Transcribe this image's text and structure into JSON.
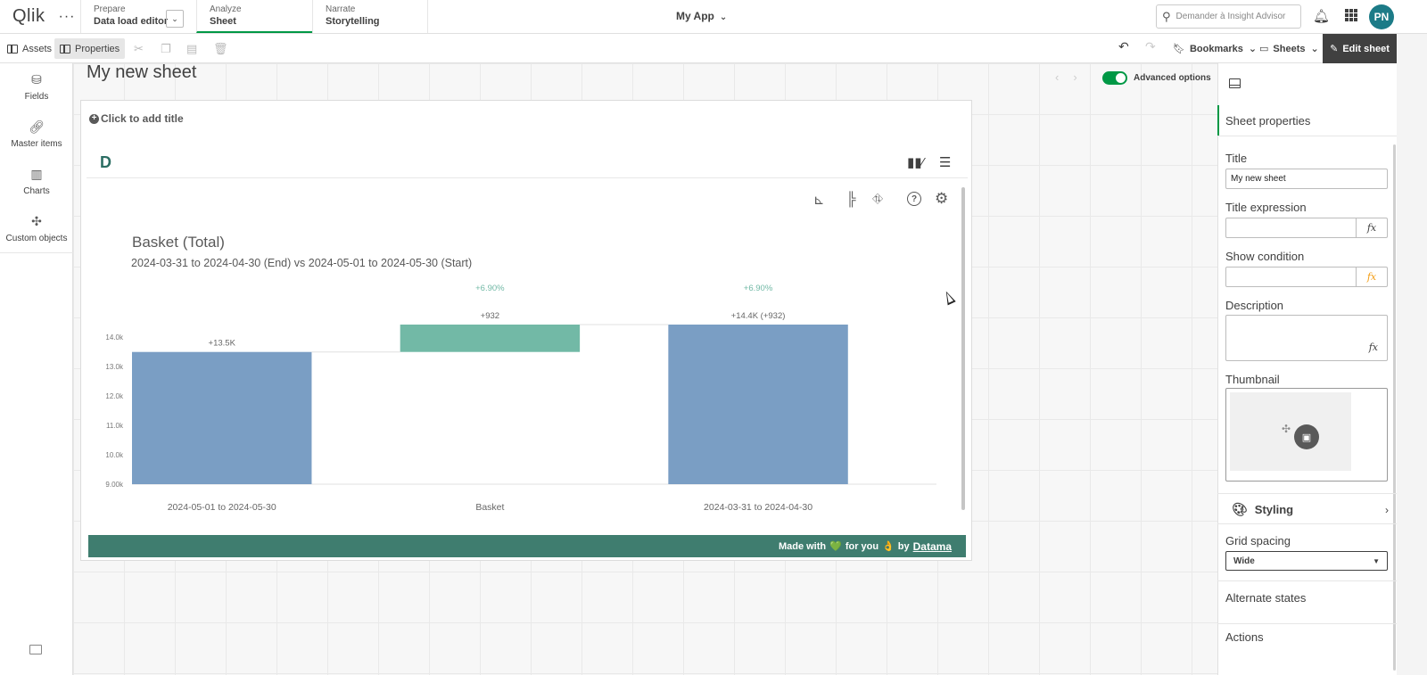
{
  "topnav": {
    "logo": "Qlik",
    "menu_dots": "···",
    "tabs": [
      {
        "top": "Prepare",
        "bottom": "Data load editor"
      },
      {
        "top": "Analyze",
        "bottom": "Sheet"
      },
      {
        "top": "Narrate",
        "bottom": "Storytelling"
      }
    ],
    "app_name": "My App",
    "search_placeholder": "Demander à Insight Advisor",
    "avatar_initials": "PN"
  },
  "toolbar": {
    "assets": "Assets",
    "properties": "Properties",
    "bookmarks": "Bookmarks",
    "sheets": "Sheets",
    "edit_sheet": "Edit sheet"
  },
  "left_panel": {
    "items": [
      {
        "label": "Fields",
        "icon": "database-icon"
      },
      {
        "label": "Master items",
        "icon": "link-icon"
      },
      {
        "label": "Charts",
        "icon": "bar-chart-icon"
      },
      {
        "label": "Custom objects",
        "icon": "puzzle-icon"
      }
    ]
  },
  "sheet": {
    "title": "My new sheet",
    "advanced_options": "Advanced options",
    "add_title": "Click to add title",
    "extension_logo": "D"
  },
  "chart_data": {
    "type": "bar",
    "subtype": "waterfall",
    "title": "Basket (Total)",
    "subtitle": "2024-03-31 to 2024-04-30 (End) vs 2024-05-01 to 2024-05-30 (Start)",
    "categories": [
      "2024-05-01 to 2024-05-30",
      "Basket",
      "2024-03-31 to 2024-04-30"
    ],
    "series": [
      {
        "values": [
          13500,
          932,
          14432
        ]
      }
    ],
    "bar_kinds": [
      "total",
      "delta",
      "total"
    ],
    "bar_colors": [
      "#7a9ec4",
      "#72b9a6",
      "#7a9ec4"
    ],
    "data_labels": [
      "+13.5K",
      "+932",
      "+14.4K (+932)"
    ],
    "percent_labels": [
      "",
      "+6.90%",
      "+6.90%"
    ],
    "y_ticks": [
      "14.0k",
      "13.0k",
      "12.0k",
      "11.0k",
      "10.0k",
      "9.00k"
    ],
    "y_tick_values": [
      14000,
      13000,
      12000,
      11000,
      10000,
      9000
    ],
    "ylim": [
      9000,
      14432
    ],
    "grid": false,
    "legend": "none"
  },
  "footer": {
    "made_with": "Made with",
    "heart": "💚",
    "for_you": "for you",
    "hand": "👌",
    "by": "by",
    "brand": "Datama"
  },
  "right_panel": {
    "header": "Sheet properties",
    "title_label": "Title",
    "title_value": "My new sheet",
    "title_expression_label": "Title expression",
    "show_condition_label": "Show condition",
    "description_label": "Description",
    "thumbnail_label": "Thumbnail",
    "styling_label": "Styling",
    "grid_spacing_label": "Grid spacing",
    "grid_spacing_value": "Wide",
    "alternate_states": "Alternate states",
    "actions": "Actions",
    "fx": "fx"
  }
}
